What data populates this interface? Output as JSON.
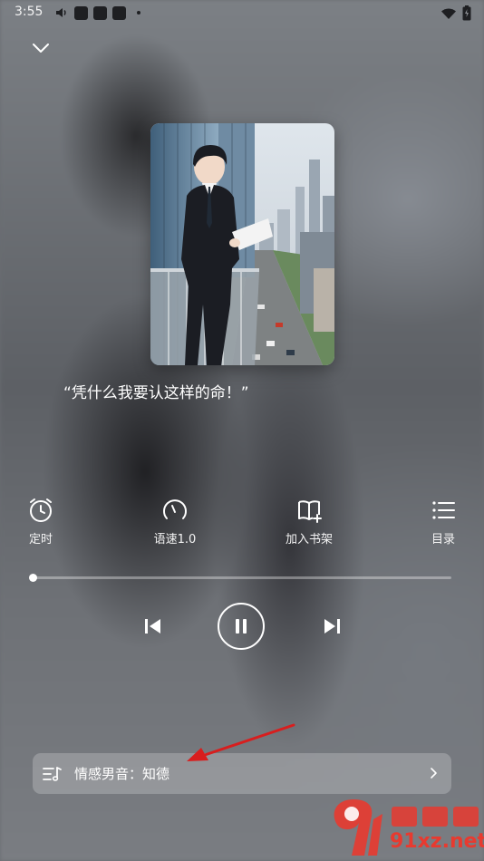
{
  "status_bar": {
    "time": "3:55"
  },
  "header": {
    "collapse_icon": "chevron-down-icon"
  },
  "cover": {
    "alt": "book-cover"
  },
  "quote": "“凭什么我要认这样的命！”",
  "controls": [
    {
      "icon": "alarm-clock-icon",
      "label": "定时"
    },
    {
      "icon": "speedometer-icon",
      "label": "语速1.0"
    },
    {
      "icon": "add-bookshelf-icon",
      "label": "加入书架"
    },
    {
      "icon": "list-icon",
      "label": "目录"
    }
  ],
  "progress": {
    "fraction": 0.0
  },
  "playback": {
    "prev_icon": "skip-previous-icon",
    "play_pause_icon": "pause-icon",
    "next_icon": "skip-next-icon"
  },
  "voice": {
    "label": "情感男音：知德",
    "icon": "voice-list-icon"
  },
  "watermark": {
    "text": "91xz.net"
  },
  "colors": {
    "accent": "#ffffff",
    "annotation_arrow": "#d81e1e",
    "watermark": "#e83a2f"
  }
}
